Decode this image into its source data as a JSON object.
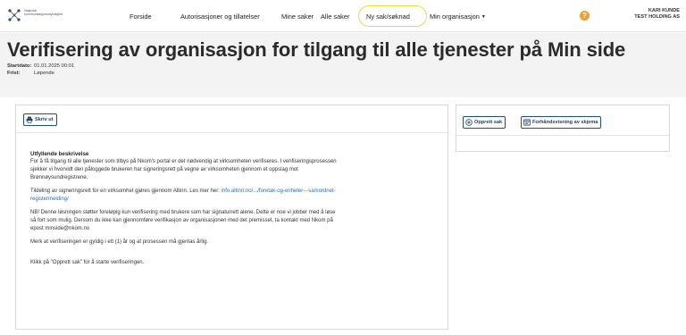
{
  "header": {
    "logo_text": "Nasjonal kommunikasjonsmyndighet",
    "nav": [
      {
        "label": "Forside"
      },
      {
        "label": "Autorisasjoner og tillatelser"
      },
      {
        "label": "Mine saker"
      },
      {
        "label": "Alle saker"
      },
      {
        "label": "Ny sak/søknad"
      },
      {
        "label": "Min organisasjon"
      }
    ],
    "highlight_color": "#f0d84a",
    "help_icon": "?",
    "user_name": "KARI KUNDE",
    "user_org": "TEST HOLDING AS"
  },
  "page": {
    "title": "Verifisering av organisasjon for tilgang til alle tjenester på Min side",
    "startdato_label": "Startdato:",
    "startdato_value": "01.01.2025 00:01",
    "frist_label": "Frist:",
    "frist_value": "Løpende"
  },
  "left_panel": {
    "print_button": "Skriv ut",
    "heading": "Utfyllende beskrivelse",
    "p1": "For å få tilgang til alle tjenester som tilbys på Nkom's portal er det nødvendig at virksomheten verifiseres. I verifiseringsprosessen sjekker vi hvorvidt den påloggede brukeren har signeringsrett på vegne av virksomheten gjennom et oppslag mot Brønnøysundregistrene.",
    "p2_text": "Tildeling av signeringsrett for en virksomhet gjøres gjennom Altinn. Les mer her: ",
    "p2_link": "info.altinn.no/.../foretak-og-enheter---samordnet-registermelding/",
    "p3": "NB! Denne løsningen støtter foreløpig kun verifisering med brukere som har signaturrett alene. Dette er noe vi jobber med å løse så fort som mulig. Dersom du ikke kan gjennomføre verifikasjon av organisasjonen med det premisset, ta kontakt med Nkom på epost minside@nkom.no",
    "p4": "Merk at verifiseringen er gyldig i ett (1) år og at prosessen må gjentas årlig.",
    "p5": "Klikk på \"Opprett sak\" for å starte verifiseringen."
  },
  "right_panel": {
    "create_button": "Opprett sak",
    "preview_button": "Forhåndsvisning av skjema"
  }
}
